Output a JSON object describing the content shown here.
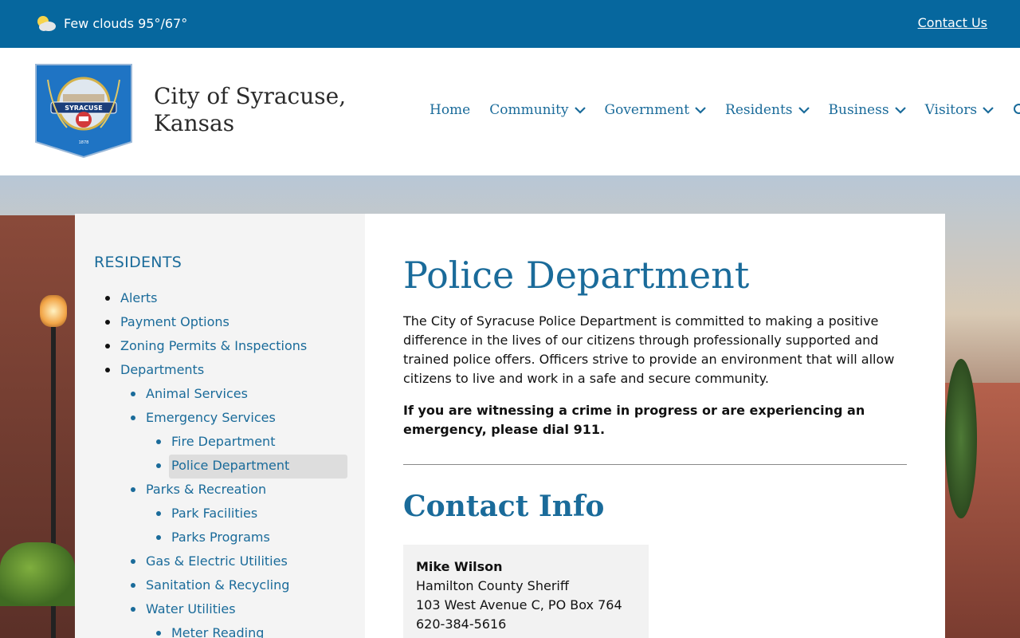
{
  "topbar": {
    "weather_text": "Few clouds 95°/67°",
    "contact_label": "Contact Us"
  },
  "header": {
    "title": "City of Syracuse, Kansas",
    "nav": [
      {
        "label": "Home",
        "has_dropdown": false
      },
      {
        "label": "Community",
        "has_dropdown": true
      },
      {
        "label": "Government",
        "has_dropdown": true
      },
      {
        "label": "Residents",
        "has_dropdown": true
      },
      {
        "label": "Business",
        "has_dropdown": true
      },
      {
        "label": "Visitors",
        "has_dropdown": true
      }
    ],
    "search_icon": "search-icon"
  },
  "sidebar": {
    "heading": "RESIDENTS",
    "items": [
      {
        "label": "Alerts",
        "level": 1
      },
      {
        "label": "Payment Options",
        "level": 1
      },
      {
        "label": "Zoning Permits & Inspections",
        "level": 1
      },
      {
        "label": "Departments",
        "level": 1
      },
      {
        "label": "Animal Services",
        "level": 2
      },
      {
        "label": "Emergency Services",
        "level": 2
      },
      {
        "label": "Fire Department",
        "level": 3
      },
      {
        "label": "Police Department",
        "level": 3,
        "active": true
      },
      {
        "label": "Parks & Recreation",
        "level": 2
      },
      {
        "label": "Park Facilities",
        "level": 3
      },
      {
        "label": "Parks Programs",
        "level": 3
      },
      {
        "label": "Gas & Electric Utilities",
        "level": 2
      },
      {
        "label": "Sanitation & Recycling",
        "level": 2
      },
      {
        "label": "Water Utilities",
        "level": 2
      },
      {
        "label": "Meter Reading",
        "level": 3
      }
    ]
  },
  "main": {
    "title": "Police Department",
    "intro": "The City of Syracuse Police Department is committed to making a positive difference in the lives of our citizens through professionally supported and trained police offers. Officers strive to provide an environment that will allow citizens to live and work in a safe and secure community.",
    "alert": "If you are witnessing a crime in progress or are experiencing an emergency, please dial 911.",
    "contact_heading": "Contact Info",
    "contact": {
      "name": "Mike Wilson",
      "title": "Hamilton County Sheriff",
      "address": "103 West Avenue C, PO Box 764",
      "phone": "620-384-5616"
    }
  },
  "colors": {
    "topbar": "#06679e",
    "link": "#1a6b9a",
    "sidebar_bg": "#f4f4f4",
    "active_bg": "#dddddd"
  }
}
